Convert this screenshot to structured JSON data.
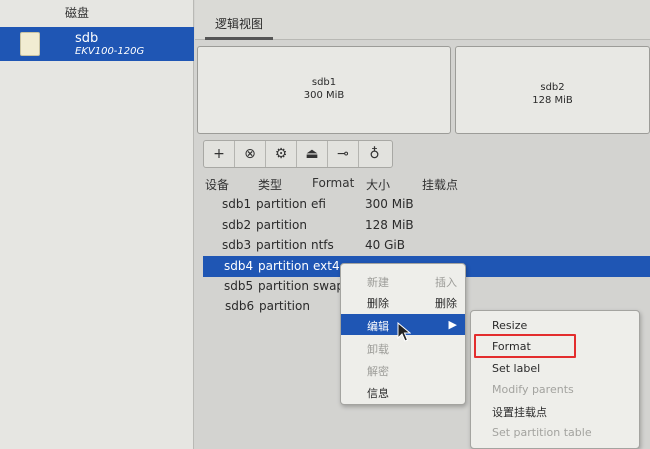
{
  "sidebar": {
    "header": "磁盘",
    "disk": {
      "name": "sdb",
      "model": "EKV100-120G"
    }
  },
  "main": {
    "tab": "逻辑视图",
    "partitions_view": [
      {
        "name": "sdb1",
        "size": "300 MiB"
      },
      {
        "name": "sdb2",
        "size": "128 MiB"
      }
    ]
  },
  "toolbar": {
    "buttons": [
      {
        "name": "add",
        "glyph": "+"
      },
      {
        "name": "delete",
        "glyph": "⊗"
      },
      {
        "name": "settings",
        "glyph": "⚙"
      },
      {
        "name": "eject",
        "glyph": "⏏"
      },
      {
        "name": "key",
        "glyph": "⊸"
      },
      {
        "name": "bulb",
        "glyph": "♁"
      }
    ]
  },
  "table": {
    "headers": [
      "设备",
      "类型",
      "Format",
      "大小",
      "挂载点"
    ],
    "rows": [
      {
        "device": "sdb1",
        "type": "partition",
        "format": "efi",
        "size": "300 MiB",
        "mount": ""
      },
      {
        "device": "sdb2",
        "type": "partition",
        "format": "",
        "size": "128 MiB",
        "mount": ""
      },
      {
        "device": "sdb3",
        "type": "partition",
        "format": "ntfs",
        "size": "40 GiB",
        "mount": ""
      },
      {
        "device": "sdb4",
        "type": "partition",
        "format": "ext4",
        "size": "",
        "mount": "",
        "selected": true
      },
      {
        "device": "sdb5",
        "type": "partition",
        "format": "swap",
        "size": "",
        "mount": ""
      },
      {
        "device": "sdb6",
        "type": "partition",
        "format": "",
        "size": "",
        "mount": ""
      }
    ]
  },
  "context_menu": {
    "items": [
      {
        "label": "新建",
        "accel": "插入",
        "disabled": true
      },
      {
        "label": "删除",
        "accel": "删除",
        "disabled": false
      },
      {
        "label": "编辑",
        "accel": "▶",
        "disabled": false,
        "active": true
      },
      {
        "label": "卸载",
        "accel": "",
        "disabled": true
      },
      {
        "label": "解密",
        "accel": "",
        "disabled": true
      },
      {
        "label": "信息",
        "accel": "",
        "disabled": false
      }
    ]
  },
  "submenu": {
    "items": [
      {
        "label": "Resize",
        "disabled": false
      },
      {
        "label": "Format",
        "disabled": false,
        "highlighted": true
      },
      {
        "label": "Set label",
        "disabled": false
      },
      {
        "label": "Modify parents",
        "disabled": true
      },
      {
        "label": "设置挂载点",
        "disabled": false
      },
      {
        "label": "Set partition table",
        "disabled": true
      }
    ]
  },
  "colors": {
    "selection": "#1f56b4",
    "highlight_box": "#e32d2d"
  }
}
